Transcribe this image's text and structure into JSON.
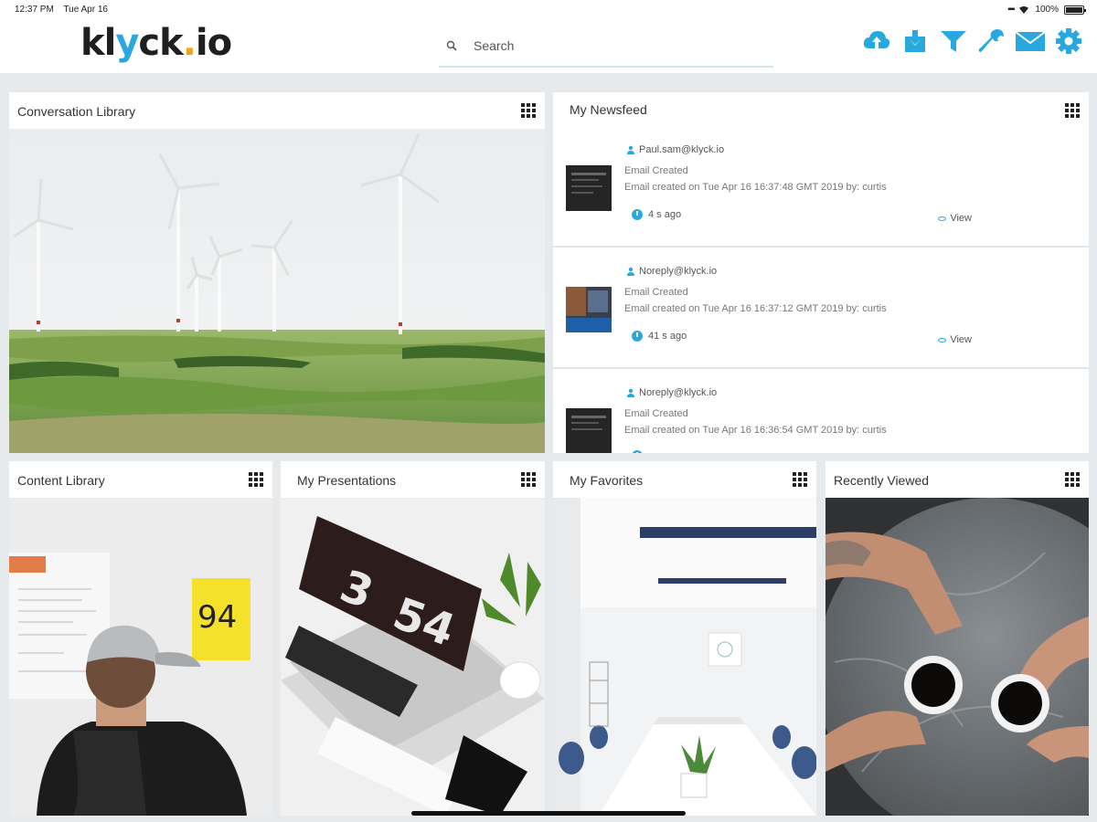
{
  "status_bar": {
    "time": "12:37 PM",
    "date": "Tue Apr 16",
    "battery": "100%"
  },
  "header": {
    "logo_parts": [
      "kl",
      "y",
      "ck",
      ".",
      "io"
    ],
    "search_placeholder": "Search",
    "toolbar_icons": [
      "cloud-upload-icon",
      "download-icon",
      "filter-icon",
      "wrench-icon",
      "mail-icon",
      "gear-icon"
    ],
    "accent_color": "#29a8e0"
  },
  "panels": {
    "conversation_library": {
      "title": "Conversation Library"
    },
    "newsfeed": {
      "title": "My Newsfeed",
      "items": [
        {
          "user": "Paul.sam@klyck.io",
          "type": "Email Created",
          "detail": "Email created on Tue Apr 16 16:37:48 GMT 2019 by: curtis",
          "time": "4 s ago",
          "action": "View"
        },
        {
          "user": "Noreply@klyck.io",
          "type": "Email Created",
          "detail": "Email created on Tue Apr 16 16:37:12 GMT 2019 by: curtis",
          "time": "41 s ago",
          "action": "View"
        },
        {
          "user": "Noreply@klyck.io",
          "type": "Email Created",
          "detail": "Email created on Tue Apr 16 16:36:54 GMT 2019 by: curtis"
        }
      ]
    },
    "content_library": {
      "title": "Content Library"
    },
    "my_presentations": {
      "title": "My Presentations",
      "clock_hour": "3",
      "clock_minutes": "54"
    },
    "my_favorites": {
      "title": "My Favorites"
    },
    "recently_viewed": {
      "title": "Recently Viewed"
    }
  }
}
